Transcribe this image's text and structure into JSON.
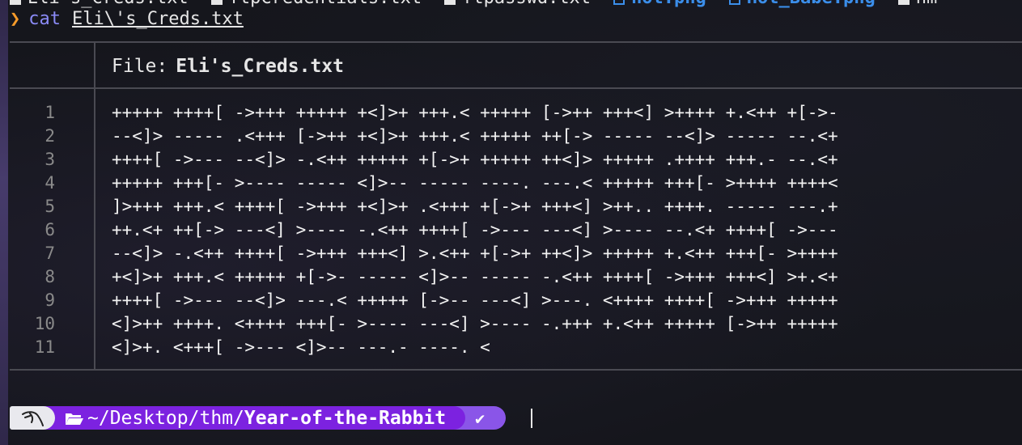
{
  "ls_row": [
    {
      "name": "Eli's_Creds.txt",
      "type": "file"
    },
    {
      "name": "ftpCredentials.txt",
      "type": "file"
    },
    {
      "name": "ftpasswd.txt",
      "type": "file"
    },
    {
      "name": "hot.png",
      "type": "image"
    },
    {
      "name": "Hot_Babe.png",
      "type": "image"
    },
    {
      "name": "hm",
      "type": "file"
    }
  ],
  "command": {
    "prompt_symbol": "❯",
    "name": "cat",
    "argument": "Eli\\'s_Creds.txt"
  },
  "bat": {
    "file_label": "File:",
    "file_name": "Eli's_Creds.txt",
    "lines": [
      {
        "num": "1",
        "text": "+++++ ++++[ ->+++ +++++ +<]>+ +++.< +++++ [->++ +++<] >++++ +.<++ +[->-"
      },
      {
        "num": "2",
        "text": "--<]> ----- .<+++ [->++ +<]>+ +++.< +++++ ++[-> ----- --<]> ----- --.<+"
      },
      {
        "num": "3",
        "text": "++++[ ->--- --<]> -.<++ +++++ +[->+ +++++ ++<]> +++++ .++++ +++.- --.<+"
      },
      {
        "num": "4",
        "text": "+++++ +++[- >---- ----- <]>-- ----- ----. ---.< +++++ +++[- >++++ ++++<"
      },
      {
        "num": "5",
        "text": "]>+++ +++.< ++++[ ->+++ +<]>+ .<+++ +[->+ +++<] >++.. ++++. ----- ---.+"
      },
      {
        "num": "6",
        "text": "++.<+ ++[-> ---<] >---- -.<++ ++++[ ->--- ---<] >---- --.<+ ++++[ ->---"
      },
      {
        "num": "7",
        "text": "--<]> -.<++ ++++[ ->+++ +++<] >.<++ +[->+ ++<]> +++++ +.<++ +++[- >++++"
      },
      {
        "num": "8",
        "text": "+<]>+ +++.< +++++ +[->- ----- <]>-- ----- -.<++ ++++[ ->+++ +++<] >+.<+"
      },
      {
        "num": "9",
        "text": "++++[ ->--- --<]> ---.< +++++ [->-- ---<] >---. <++++ ++++[ ->+++ +++++"
      },
      {
        "num": "10",
        "text": "<]>++ ++++. <++++ +++[- >---- ---<] >---- -.+++ +.<++ +++++ [->++ +++++"
      },
      {
        "num": "11",
        "text": "<]>+. <+++[ ->--- <]>-- ---.- ----. <"
      }
    ]
  },
  "prompt": {
    "path_prefix": "~/Desktop/thm/",
    "path_bold": "Year-of-the-Rabbit",
    "status": "✔"
  },
  "colors": {
    "accent_purple": "#7c22e0",
    "prompt_orange": "#f59b2a",
    "command_blue": "#8b8bf7",
    "image_blue": "#3b8eea"
  }
}
